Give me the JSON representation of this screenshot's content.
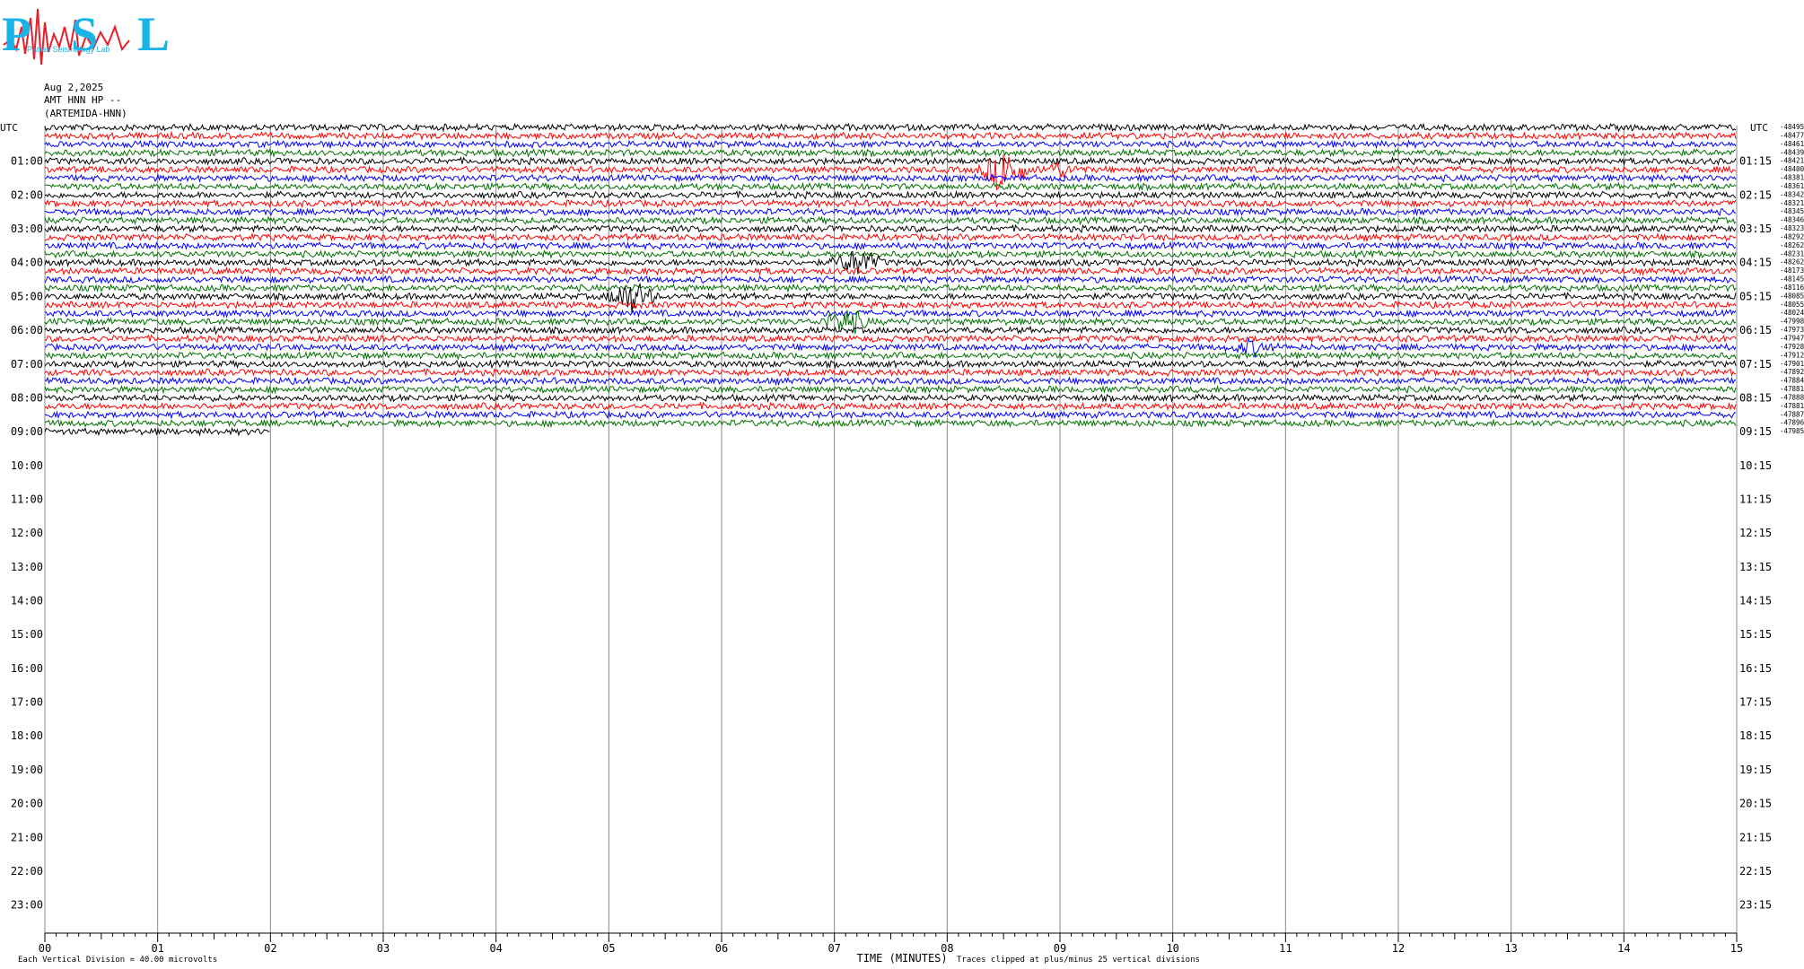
{
  "header": {
    "logo_text": "PSL",
    "logo_subtext": "Patras Seismology Lab",
    "date": "Aug 2,2025",
    "channel": "AMT HNN HP --",
    "station": "(ARTEMIDA-HNN)"
  },
  "chart_data": {
    "type": "line",
    "left_axis_label": "UTC",
    "right_axis_label": "UTC",
    "left_hour_labels": [
      "01:00",
      "02:00",
      "03:00",
      "04:00",
      "05:00",
      "06:00",
      "07:00",
      "08:00",
      "09:00",
      "10:00",
      "11:00",
      "12:00",
      "13:00",
      "14:00",
      "15:00",
      "16:00",
      "17:00",
      "18:00",
      "19:00",
      "20:00",
      "21:00",
      "22:00",
      "23:00"
    ],
    "right_hour_labels": [
      "01:15",
      "02:15",
      "03:15",
      "04:15",
      "05:15",
      "06:15",
      "07:15",
      "08:15",
      "09:15",
      "10:15",
      "11:15",
      "12:15",
      "13:15",
      "14:15",
      "15:15",
      "16:15",
      "17:15",
      "18:15",
      "19:15",
      "20:15",
      "21:15",
      "22:15",
      "23:15"
    ],
    "x_tick_labels": [
      "00",
      "01",
      "02",
      "03",
      "04",
      "05",
      "06",
      "07",
      "08",
      "09",
      "10",
      "11",
      "12",
      "13",
      "14",
      "15"
    ],
    "xlabel": "TIME (MINUTES)",
    "xlim": [
      0,
      15
    ],
    "rows_total": 96,
    "rows_recorded": 37,
    "last_row_end_minute": 2.0,
    "trace_colors": [
      "#000000",
      "#ff0000",
      "#0000ff",
      "#007000"
    ],
    "row_offsets": [
      "-48495",
      "-48477",
      "-48461",
      "-48439",
      "-48421",
      "-48400",
      "-48381",
      "-48361",
      "-48342",
      "-48321",
      "-48345",
      "-48346",
      "-48323",
      "-48292",
      "-48262",
      "-48231",
      "-48262",
      "-48173",
      "-48145",
      "-48116",
      "-48085",
      "-48055",
      "-48024",
      "-47998",
      "-47973",
      "-47947",
      "-47928",
      "-47912",
      "-47901",
      "-47892",
      "-47884",
      "-47881",
      "-47888",
      "-47881",
      "-47887",
      "-47896",
      "-47985"
    ],
    "events": [
      {
        "row": 5,
        "minute": 8.5,
        "amplitude": 3.5
      },
      {
        "row": 5,
        "minute": 9.0,
        "amplitude": 1.0
      },
      {
        "row": 16,
        "minute": 7.2,
        "amplitude": 2.2
      },
      {
        "row": 20,
        "minute": 5.2,
        "amplitude": 2.5
      },
      {
        "row": 23,
        "minute": 7.1,
        "amplitude": 2.0
      },
      {
        "row": 26,
        "minute": 10.7,
        "amplitude": 1.0
      }
    ],
    "footer_left": "Each Vertical Division =  40.00 microvolts",
    "footer_note": "Traces clipped at plus/minus 25 vertical divisions"
  }
}
